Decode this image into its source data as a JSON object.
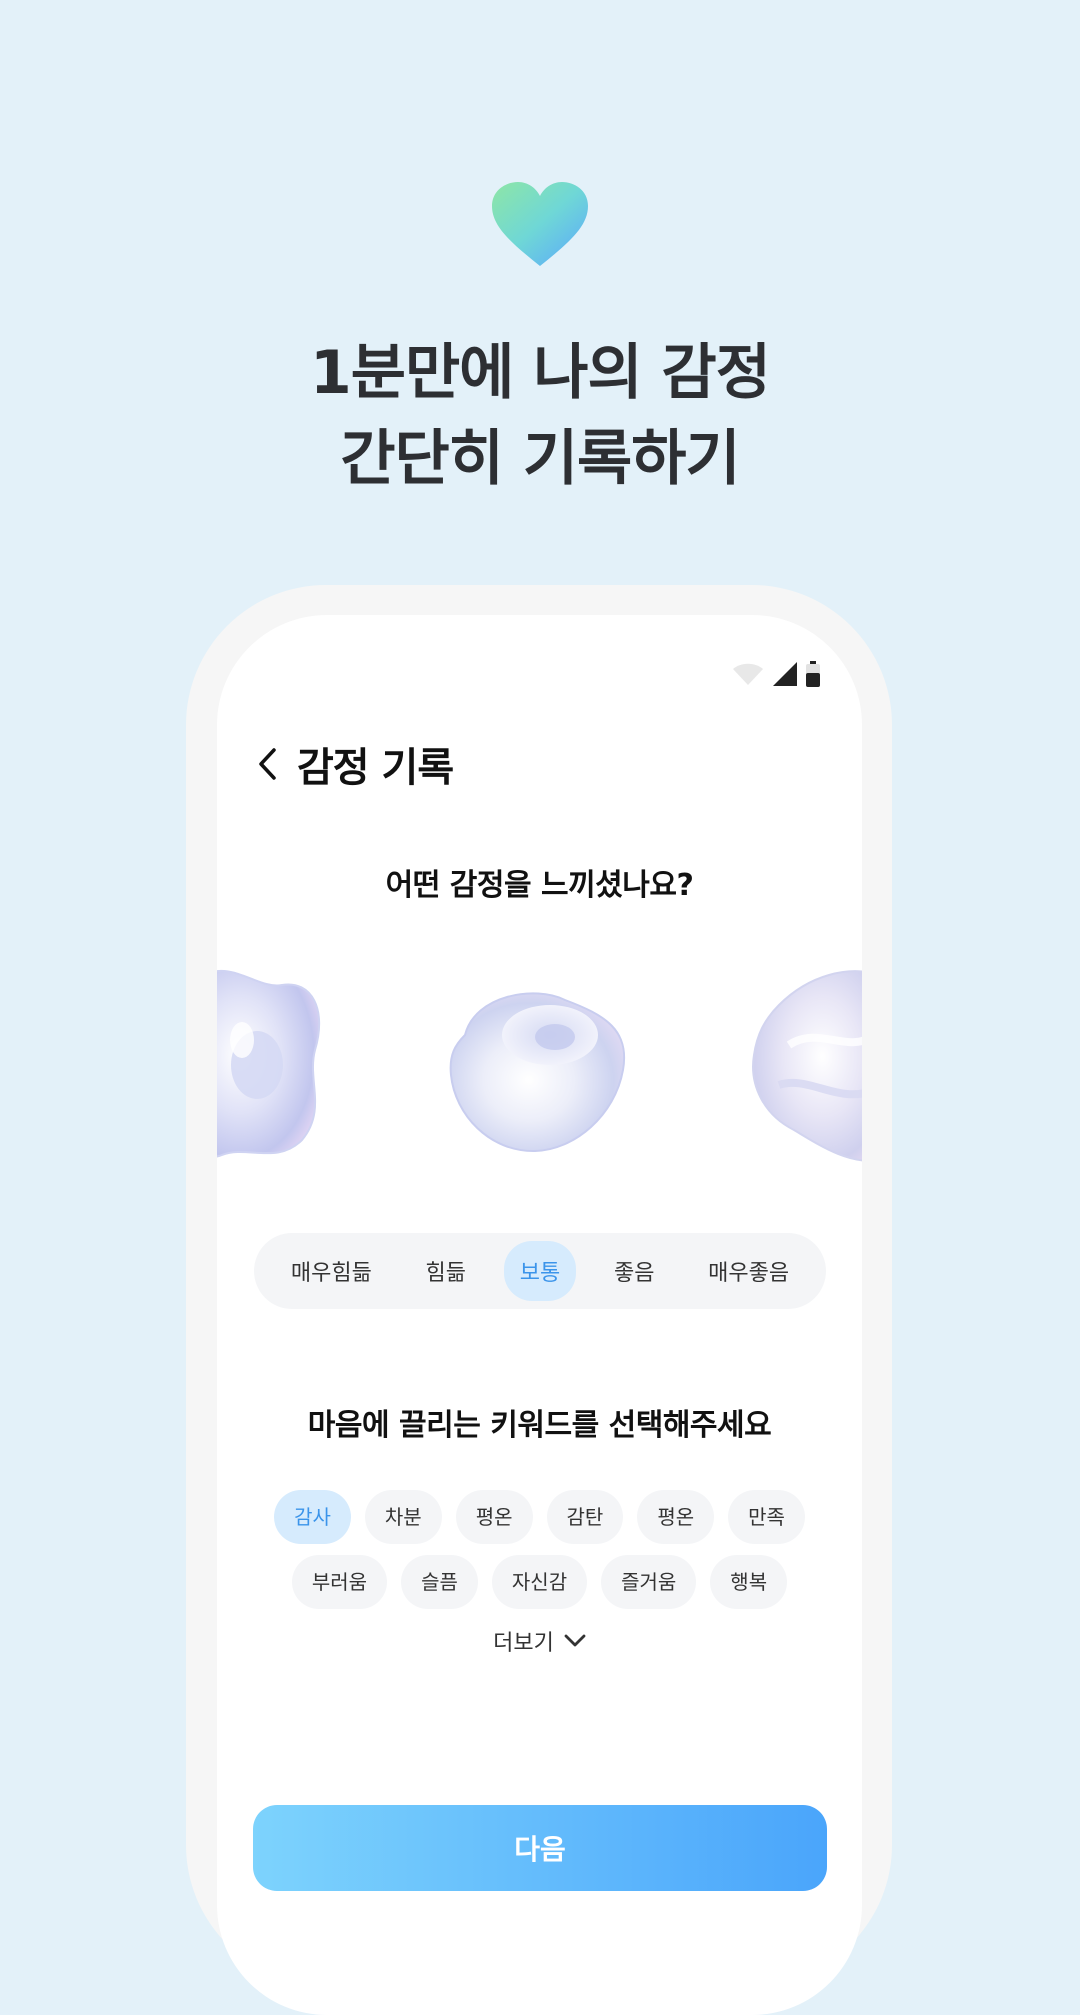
{
  "headline": {
    "line1": "1분만에 나의 감정",
    "line2": "간단히 기록하기"
  },
  "appbar": {
    "title": "감정 기록"
  },
  "question": "어떤 감정을 느끼셨나요?",
  "mood_scale": {
    "items": [
      "매우힘듦",
      "힘듦",
      "보통",
      "좋음",
      "매우좋음"
    ],
    "selected": "보통"
  },
  "keywords": {
    "title": "마음에 끌리는 키워드를 선택해주세요",
    "row1": [
      "감사",
      "차분",
      "평온",
      "감탄",
      "평온",
      "만족"
    ],
    "row2": [
      "부러움",
      "슬픔",
      "자신감",
      "즐거움",
      "행복"
    ],
    "selected": "감사",
    "more_label": "더보기"
  },
  "next_button": "다음",
  "colors": {
    "accent": "#3b94ea",
    "background": "#e3f1f9",
    "chip_selected_bg": "#d6ebfd"
  }
}
